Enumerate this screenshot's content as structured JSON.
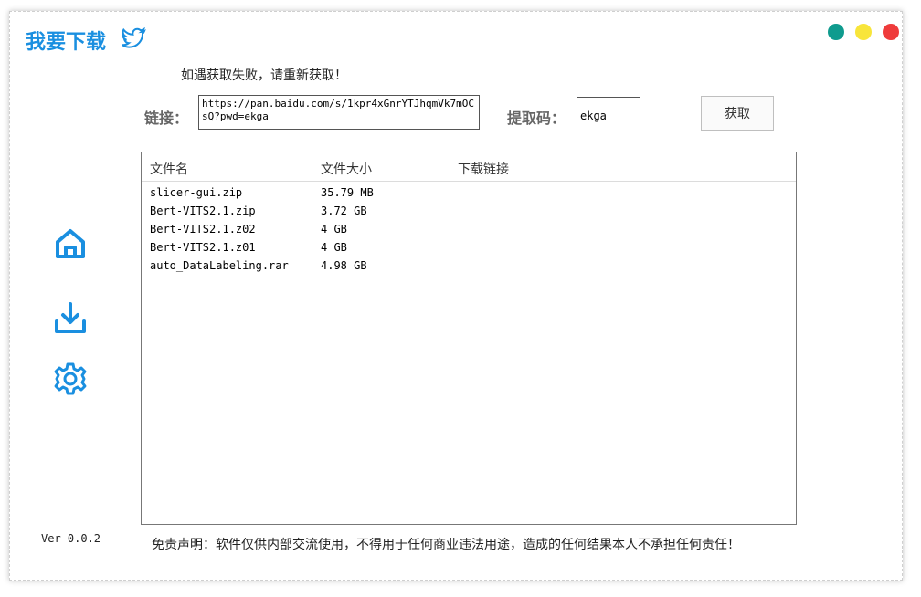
{
  "app": {
    "title": "我要下载"
  },
  "window_controls": {
    "colors": [
      "#0f9b8e",
      "#f8e53a",
      "#ef3b3b"
    ]
  },
  "notice": "如遇获取失败，请重新获取！",
  "form": {
    "link_label": "链接：",
    "link_value": "https://pan.baidu.com/s/1kpr4xGnrYTJhqmVk7mOCsQ?pwd=ekga",
    "code_label": "提取码：",
    "code_value": "ekga",
    "fetch_button": "获取"
  },
  "table": {
    "headers": [
      "文件名",
      "文件大小",
      "下载链接"
    ],
    "rows": [
      {
        "name": "slicer-gui.zip",
        "size": "35.79 MB",
        "link": ""
      },
      {
        "name": "Bert-VITS2.1.zip",
        "size": "3.72 GB",
        "link": ""
      },
      {
        "name": "Bert-VITS2.1.z02",
        "size": "4 GB",
        "link": ""
      },
      {
        "name": "Bert-VITS2.1.z01",
        "size": "4 GB",
        "link": ""
      },
      {
        "name": "auto_DataLabeling.rar",
        "size": "4.98 GB",
        "link": ""
      }
    ]
  },
  "sidebar": {
    "icons": [
      "home-icon",
      "download-icon",
      "settings-icon"
    ],
    "accent": "#1a8fe0"
  },
  "version": "Ver 0.0.2",
  "disclaimer": "免责声明：软件仅供内部交流使用，不得用于任何商业违法用途，造成的任何结果本人不承担任何责任！"
}
